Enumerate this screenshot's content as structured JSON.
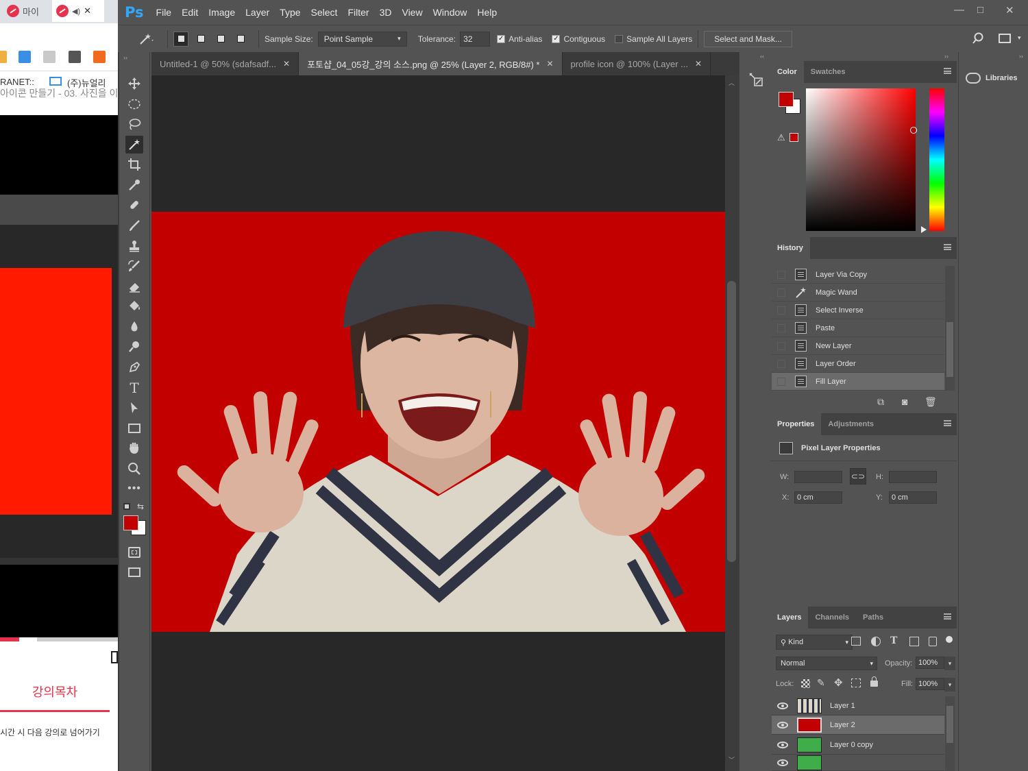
{
  "browser": {
    "tabs": [
      "마이",
      ""
    ],
    "bookmarks": [
      "RANET::",
      "(주)뉴얼리"
    ],
    "page_title": "아이콘 만들기 - 03. 사진을 이",
    "toc_label": "강의목차",
    "toc_sub": "시간 시 다음 강의로 넘어가기"
  },
  "app": {
    "logo": "Ps",
    "menu": [
      "File",
      "Edit",
      "Image",
      "Layer",
      "Type",
      "Select",
      "Filter",
      "3D",
      "View",
      "Window",
      "Help"
    ],
    "window_buttons": [
      "—",
      "□",
      "✕"
    ]
  },
  "options": {
    "sample_size_label": "Sample Size:",
    "sample_size_value": "Point Sample",
    "tolerance_label": "Tolerance:",
    "tolerance_value": "32",
    "anti_alias": "Anti-alias",
    "contiguous": "Contiguous",
    "sample_all_layers": "Sample All Layers",
    "select_mask": "Select and Mask..."
  },
  "tabs": [
    {
      "label": "Untitled-1 @ 50% (sdafsadf...",
      "close": "✕"
    },
    {
      "label": "포토샵_04_05강_강의 소스.png @ 25% (Layer 2, RGB/8#) *",
      "close": "✕"
    },
    {
      "label": "profile icon @ 100% (Layer ...",
      "close": "✕"
    }
  ],
  "color_panel": {
    "tabs": [
      "Color",
      "Swatches"
    ],
    "fg": "#c30000",
    "bg": "#ffffff"
  },
  "libraries": {
    "label": "Libraries"
  },
  "history": {
    "title": "History",
    "items": [
      "Layer Via Copy",
      "Magic Wand",
      "Select Inverse",
      "Paste",
      "New Layer",
      "Layer Order",
      "Fill Layer"
    ]
  },
  "properties": {
    "tabs": [
      "Properties",
      "Adjustments"
    ],
    "heading": "Pixel Layer Properties",
    "w_label": "W:",
    "h_label": "H:",
    "x_label": "X:",
    "y_label": "Y:",
    "x_value": "0 cm",
    "y_value": "0 cm"
  },
  "layers": {
    "tabs": [
      "Layers",
      "Channels",
      "Paths"
    ],
    "kind": "Kind",
    "blend": "Normal",
    "opacity_label": "Opacity:",
    "opacity_value": "100%",
    "lock_label": "Lock:",
    "fill_label": "Fill:",
    "fill_value": "100%",
    "items": [
      "Layer 1",
      "Layer 2",
      "Layer 0 copy"
    ]
  }
}
